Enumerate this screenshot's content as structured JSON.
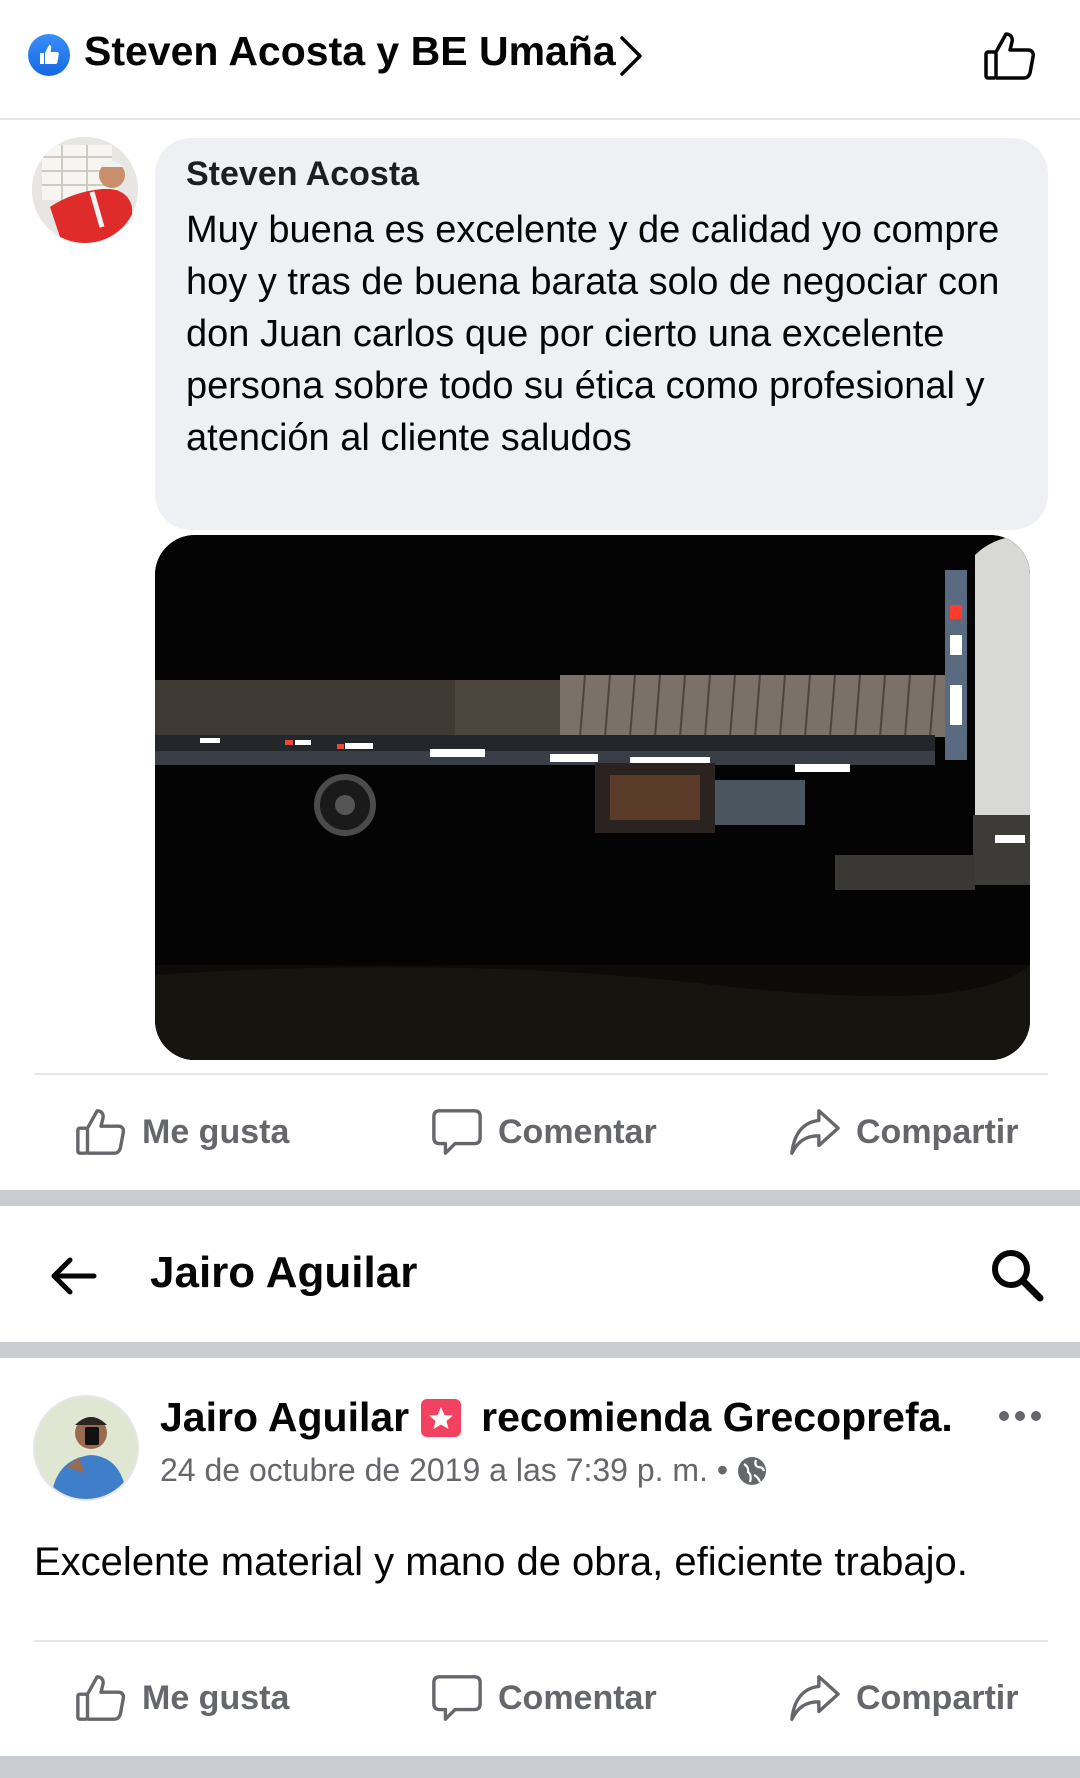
{
  "header": {
    "title": "Steven Acosta y BE Umaña",
    "accent_color": "#1877f2"
  },
  "comment": {
    "author": "Steven Acosta",
    "text": "Muy buena es excelente y de calidad yo compre hoy y tras de buena barata solo de negociar con don Juan carlos que por cierto una excelente persona sobre todo su ética como profesional y atención al cliente saludos"
  },
  "actions_1": {
    "like_label": "Me gusta",
    "comment_label": "Comentar",
    "share_label": "Compartir"
  },
  "profile_bar": {
    "name": "Jairo Aguilar"
  },
  "post": {
    "author": "Jairo Aguilar",
    "recommends": "recomienda Grecoprefa.",
    "timestamp": "24 de octubre de 2019 a las 7:39 p. m. •",
    "text": "Excelente material y mano de obra, eficiente trabajo.",
    "recommend_color": "#f3425f"
  },
  "actions_2": {
    "like_label": "Me gusta",
    "comment_label": "Comentar",
    "share_label": "Compartir"
  }
}
